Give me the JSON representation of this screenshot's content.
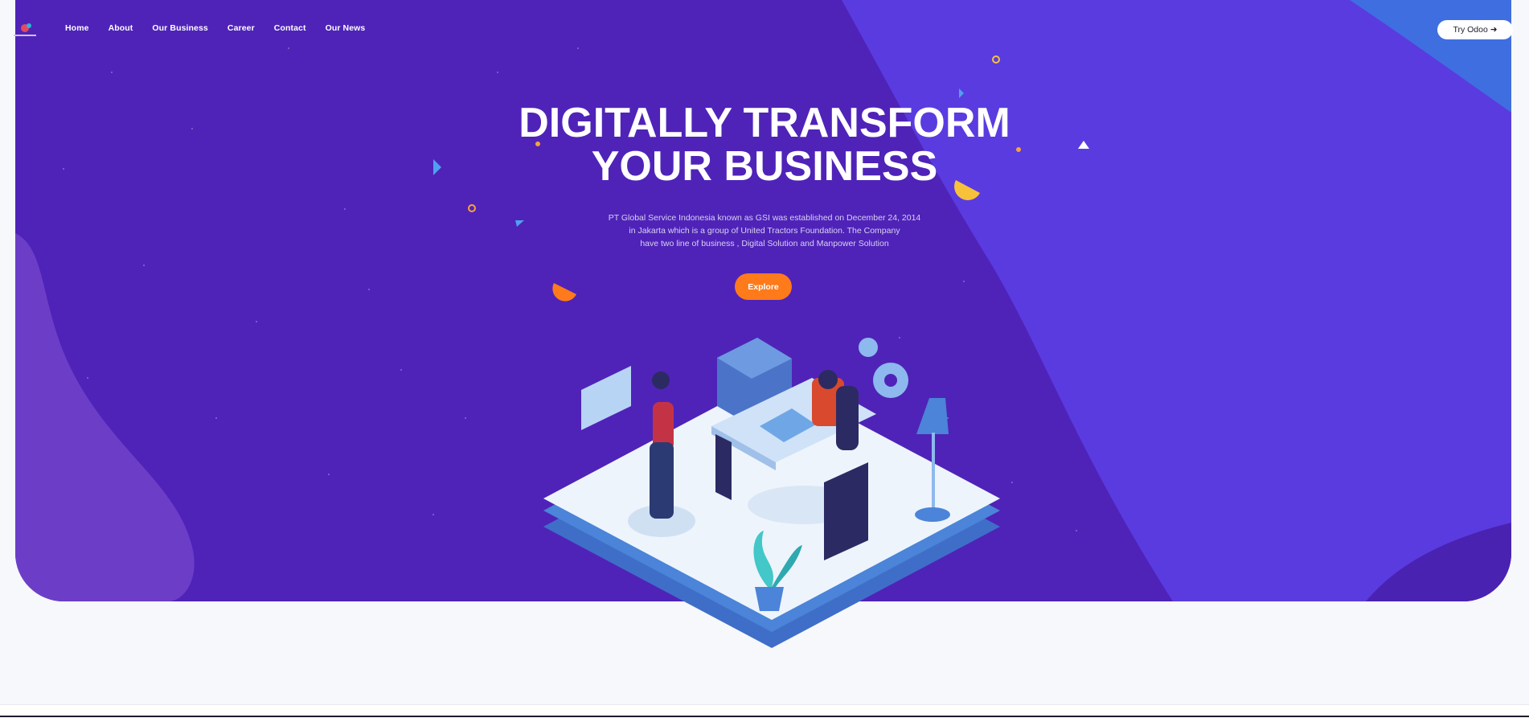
{
  "nav": {
    "logo_icon": "company-logo",
    "links": [
      "Home",
      "About",
      "Our Business",
      "Career",
      "Contact",
      "Our News"
    ],
    "try_button": "Try Odoo ➜"
  },
  "hero": {
    "headline_line1": "DIGITALLY TRANSFORM",
    "headline_line2": "YOUR BUSINESS",
    "description_line1": "PT Global Service Indonesia known as GSI was established on December 24, 2014",
    "description_line2": "in Jakarta which is a group of United Tractors Foundation. The Company",
    "description_line3": "have two line of business , Digital Solution and Manpower Solution",
    "explore_button": "Explore",
    "illustration": "isometric-office-illustration"
  },
  "colors": {
    "hero_bg": "#4f23b8",
    "hero_wave": "#5a3be0",
    "accent_orange": "#ff7a1a",
    "page_bg": "#f6f8fb"
  }
}
